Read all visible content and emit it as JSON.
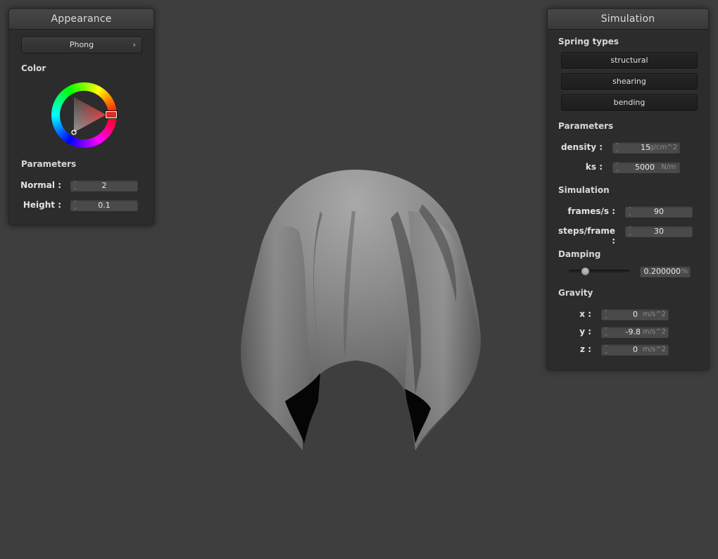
{
  "appearance": {
    "title": "Appearance",
    "shader_select": "Phong",
    "color_label": "Color",
    "color": "#d92b2b",
    "parameters_label": "Parameters",
    "normal": {
      "label": "Normal :",
      "value": "2"
    },
    "height": {
      "label": "Height :",
      "value": "0.1"
    }
  },
  "simulation": {
    "title": "Simulation",
    "spring_types_label": "Spring types",
    "spring_buttons": [
      "structural",
      "shearing",
      "bending"
    ],
    "parameters_label": "Parameters",
    "density": {
      "label": "density :",
      "value": "15",
      "unit": "g/cm^2"
    },
    "ks": {
      "label": "ks :",
      "value": "5000",
      "unit": "N/m"
    },
    "simulation_label": "Simulation",
    "frames": {
      "label": "frames/s :",
      "value": "90"
    },
    "steps": {
      "label": "steps/frame :",
      "value": "30"
    },
    "damping_label": "Damping",
    "damping": {
      "value": "0.200000",
      "unit": "%",
      "level": 0.2
    },
    "gravity_label": "Gravity",
    "gravity_x": {
      "label": "x :",
      "value": "0",
      "unit": "m/s^2"
    },
    "gravity_y": {
      "label": "y :",
      "value": "-9.8",
      "unit": "m/s^2"
    },
    "gravity_z": {
      "label": "z :",
      "value": "0",
      "unit": "m/s^2"
    }
  },
  "scene": {
    "background": "#3e3e3e",
    "cloth_color": "#8a8a8a"
  }
}
